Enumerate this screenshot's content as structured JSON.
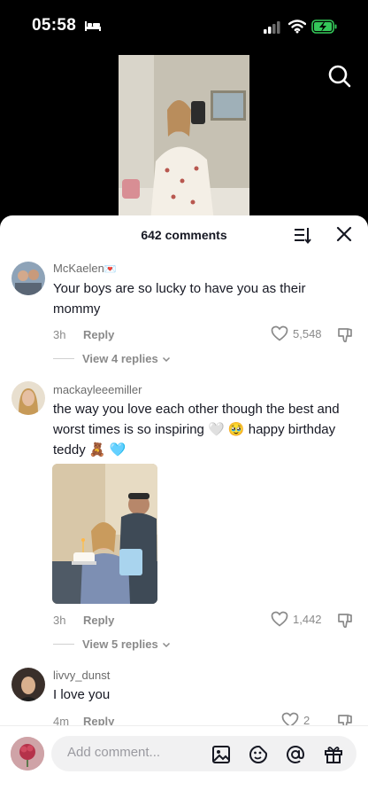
{
  "status_bar": {
    "time": "05:58"
  },
  "sheet": {
    "comment_count_label": "642 comments"
  },
  "comments": [
    {
      "username": "McKaelen",
      "username_emoji": "💌",
      "text": "Your boys are so lucky to have you as their mommy",
      "time": "3h",
      "reply_label": "Reply",
      "likes": "5,548",
      "view_replies": "View 4 replies"
    },
    {
      "username": "mackayleeemiller",
      "text": "the way you love each other though the best and worst times is so inspiring 🤍 🥹 happy birthday teddy 🧸 🩵",
      "time": "3h",
      "reply_label": "Reply",
      "likes": "1,442",
      "view_replies": "View 5 replies"
    },
    {
      "username": "livvy_dunst",
      "text": "I love you",
      "time": "4m",
      "reply_label": "Reply",
      "likes": "2"
    }
  ],
  "composer": {
    "placeholder": "Add comment..."
  },
  "colors": {
    "accent": "#e8445a",
    "text_primary": "#161823",
    "text_secondary": "#8a8a8a",
    "battery": "#34c759"
  }
}
